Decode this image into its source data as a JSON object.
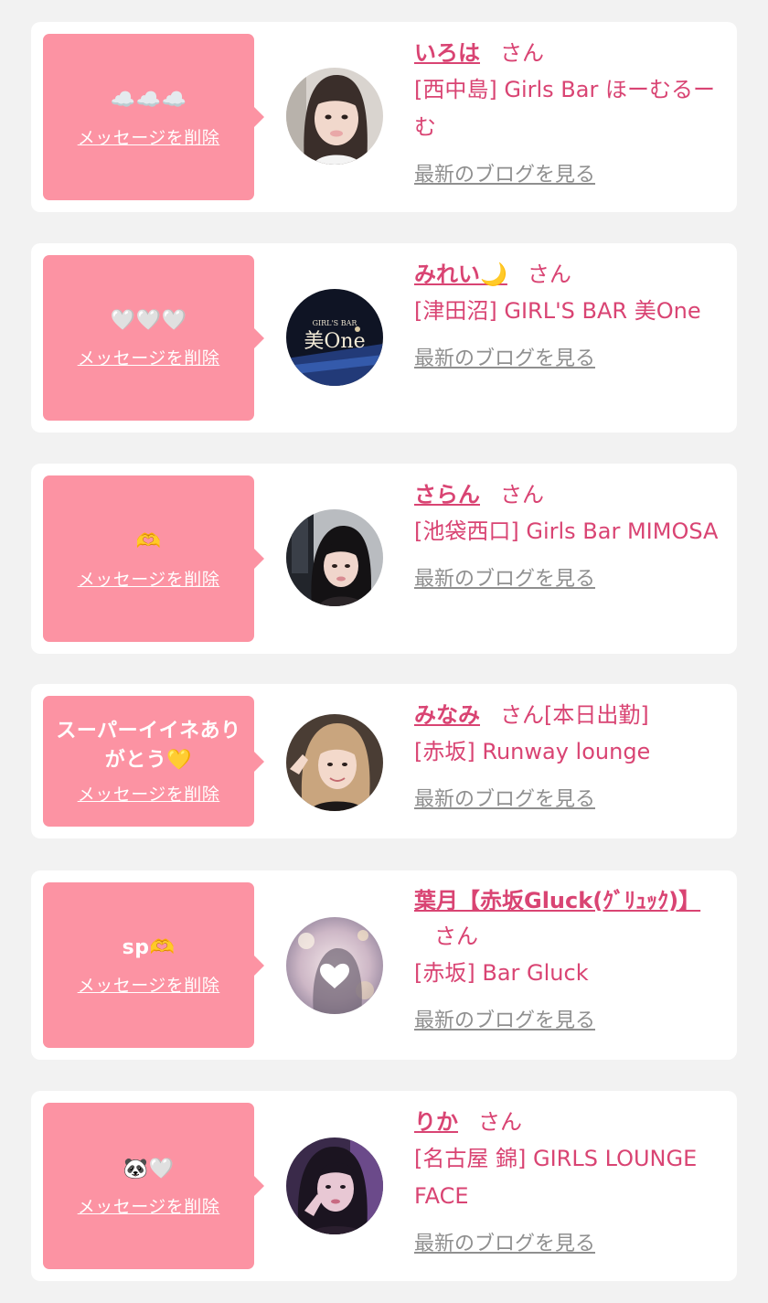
{
  "colors": {
    "accent_pink": "#d94473",
    "bubble_pink": "#fc93a3",
    "link_gray": "#8f8f8f",
    "background": "#f2f2f2"
  },
  "delete_label": "メッセージを削除",
  "honorific": "さん",
  "blog_link_label": "最新のブログを見る",
  "messages": [
    {
      "message": "☁️☁️☁️",
      "name": "いろは",
      "status": "",
      "shop": "[西中島] Girls Bar ほーむるーむ",
      "avatar": "avatar-photo"
    },
    {
      "message": "🤍🤍🤍",
      "name": "みれい🌙",
      "status": "",
      "shop": "[津田沼] GIRL'S BAR 美One",
      "avatar": "avatar-logo-bione",
      "avatar_text_small": "GIRL'S BAR",
      "avatar_text_large": "美One"
    },
    {
      "message": "🫶",
      "name": "さらん",
      "status": "",
      "shop": "[池袋西口] Girls Bar MIMOSA",
      "avatar": "avatar-photo"
    },
    {
      "message": "スーパーイイネありがとう💛",
      "name": "みなみ",
      "status": "[本日出勤]",
      "shop": "[赤坂] Runway lounge",
      "avatar": "avatar-photo"
    },
    {
      "message": "sp🫶",
      "name": "葉月【赤坂Gluck(ｸﾞﾘｭｯｸ)】",
      "status": "",
      "shop": "[赤坂] Bar Gluck",
      "avatar": "avatar-photo-heart"
    },
    {
      "message": "🐼🤍",
      "name": "りか",
      "status": "",
      "shop": "[名古屋 錦] GIRLS LOUNGE FACE",
      "avatar": "avatar-photo"
    }
  ]
}
